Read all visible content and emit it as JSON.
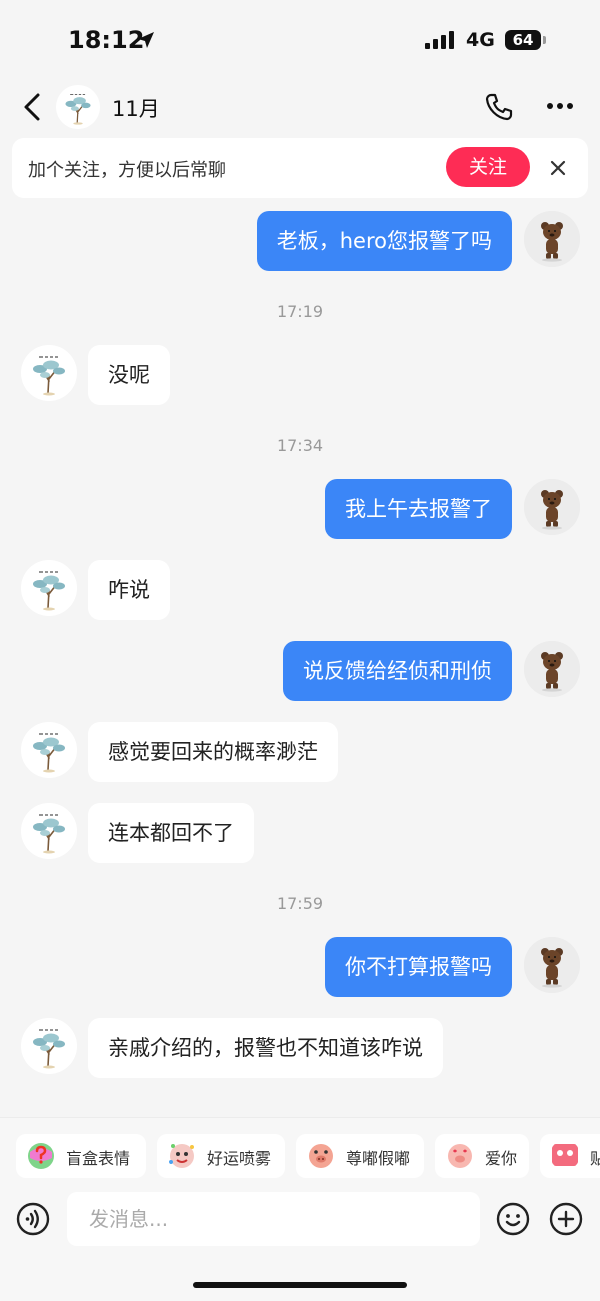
{
  "status_bar": {
    "time": "18:12",
    "network": "4G",
    "battery": "64"
  },
  "header": {
    "title": "11月"
  },
  "banner": {
    "text": "加个关注，方便以后常聊",
    "follow_label": "关注"
  },
  "messages": [
    {
      "from": "me",
      "text": "老板，hero您报警了吗"
    },
    {
      "time": "17:19"
    },
    {
      "from": "them",
      "text": "没呢"
    },
    {
      "time": "17:34"
    },
    {
      "from": "me",
      "text": "我上午去报警了"
    },
    {
      "from": "them",
      "text": "咋说"
    },
    {
      "from": "me",
      "text": "说反馈给经侦和刑侦"
    },
    {
      "from": "them",
      "text": "感觉要回来的概率渺茫"
    },
    {
      "from": "them",
      "text": "连本都回不了"
    },
    {
      "time": "17:59"
    },
    {
      "from": "me",
      "text": "你不打算报警吗"
    },
    {
      "from": "them",
      "text": "亲戚介绍的，报警也不知道该咋说"
    }
  ],
  "stickers": [
    {
      "label": "盲盒表情",
      "icon": "mystery-box-icon"
    },
    {
      "label": "好运喷雾",
      "icon": "lucky-spray-icon"
    },
    {
      "label": "尊嘟假嘟",
      "icon": "pig-face-icon"
    },
    {
      "label": "爱你",
      "icon": "pig-love-icon"
    },
    {
      "label": "贴",
      "icon": "sticker-icon"
    }
  ],
  "input": {
    "placeholder": "发消息..."
  },
  "colors": {
    "accent": "#3b86f7",
    "follow": "#fe2c55",
    "background": "#f5f5f5"
  }
}
